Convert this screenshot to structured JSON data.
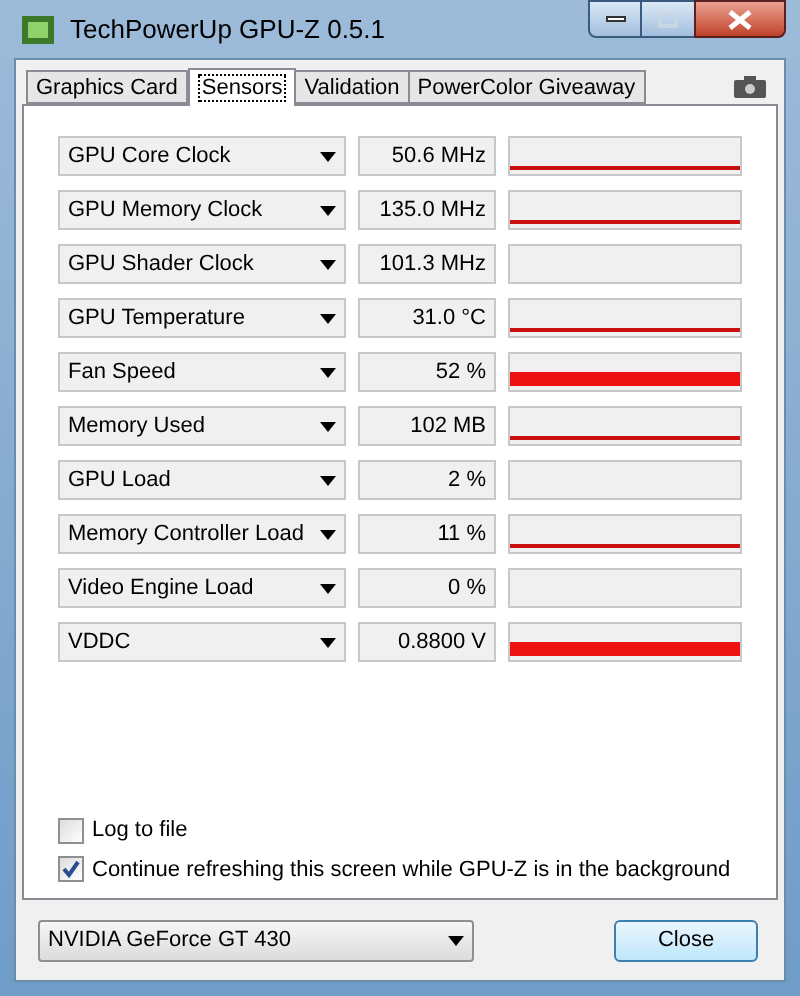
{
  "window": {
    "title": "TechPowerUp GPU-Z 0.5.1"
  },
  "tabs": [
    {
      "label": "Graphics Card",
      "selected": false
    },
    {
      "label": "Sensors",
      "selected": true
    },
    {
      "label": "Validation",
      "selected": false
    },
    {
      "label": "PowerColor Giveaway",
      "selected": false
    }
  ],
  "sensors": [
    {
      "name": "GPU Core Clock",
      "reading": "50.6 MHz",
      "graph": {
        "kind": "line"
      }
    },
    {
      "name": "GPU Memory Clock",
      "reading": "135.0 MHz",
      "graph": {
        "kind": "line"
      }
    },
    {
      "name": "GPU Shader Clock",
      "reading": "101.3 MHz",
      "graph": {
        "kind": "empty"
      }
    },
    {
      "name": "GPU Temperature",
      "reading": "31.0 °C",
      "graph": {
        "kind": "line"
      }
    },
    {
      "name": "Fan Speed",
      "reading": "52 %",
      "graph": {
        "kind": "bar"
      }
    },
    {
      "name": "Memory Used",
      "reading": "102 MB",
      "graph": {
        "kind": "line"
      }
    },
    {
      "name": "GPU Load",
      "reading": "2 %",
      "graph": {
        "kind": "empty"
      }
    },
    {
      "name": "Memory Controller Load",
      "reading": "11 %",
      "graph": {
        "kind": "line"
      }
    },
    {
      "name": "Video Engine Load",
      "reading": "0 %",
      "graph": {
        "kind": "empty"
      }
    },
    {
      "name": "VDDC",
      "reading": "0.8800 V",
      "graph": {
        "kind": "bar"
      }
    }
  ],
  "options": [
    {
      "label": "Log to file",
      "checked": false
    },
    {
      "label": "Continue refreshing this screen while GPU-Z is in the background",
      "checked": true
    }
  ],
  "device": {
    "value": "NVIDIA GeForce GT 430"
  },
  "close_button": "Close"
}
